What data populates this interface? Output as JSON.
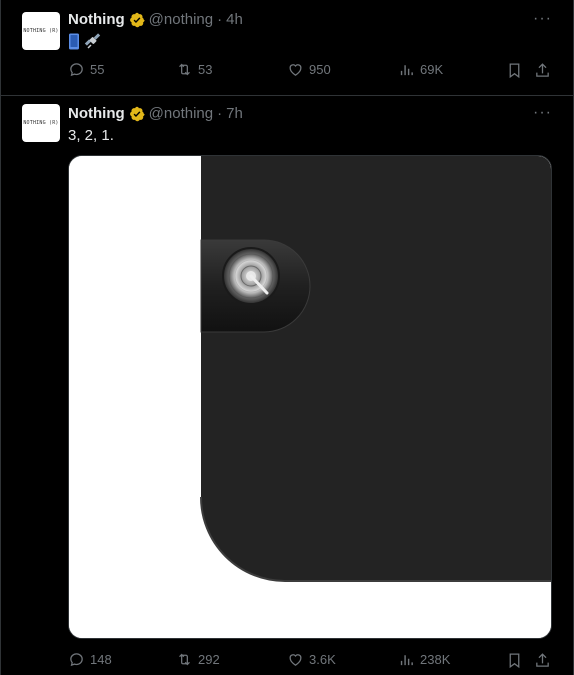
{
  "tweets": [
    {
      "author": "Nothing",
      "handle": "@nothing",
      "time": "4h",
      "avatar_text": "NOTHING (R)",
      "text": "",
      "emojis": [
        "phone-icon",
        "satellite-icon"
      ],
      "replies": "55",
      "reposts": "53",
      "likes": "950",
      "views": "69K"
    },
    {
      "author": "Nothing",
      "handle": "@nothing",
      "time": "7h",
      "avatar_text": "NOTHING (R)",
      "text": "3, 2, 1.",
      "replies": "148",
      "reposts": "292",
      "likes": "3.6K",
      "views": "238K",
      "media": "black device corner with circular camera button"
    }
  ],
  "colors": {
    "background": "#000000",
    "text": "#e7e9ea",
    "muted": "#71767b",
    "verified_badge": "#e2b719",
    "border": "#2f3336"
  }
}
